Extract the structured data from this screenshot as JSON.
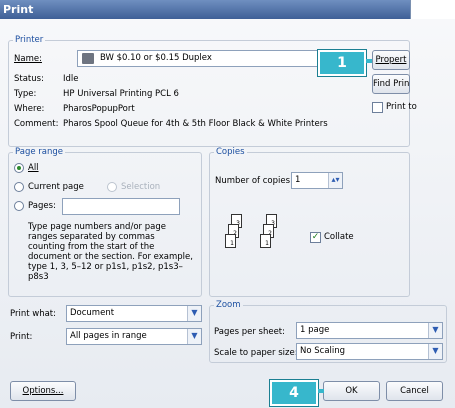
{
  "title": "Print",
  "printer": {
    "legend": "Printer",
    "name_label": "Name:",
    "name_value": "BW $0.10 or $0.15 Duplex",
    "status_label": "Status:",
    "status_value": "Idle",
    "type_label": "Type:",
    "type_value": "HP Universal Printing PCL 6",
    "where_label": "Where:",
    "where_value": "PharosPopupPort",
    "comment_label": "Comment:",
    "comment_value": "Pharos Spool Queue for 4th & 5th Floor Black & White Printers",
    "properties_button": "Propert",
    "find_printer_button": "Find Print",
    "print_to_file_label": "Print to"
  },
  "page_range": {
    "legend": "Page range",
    "all_label": "All",
    "current_page_label": "Current page",
    "selection_label": "Selection",
    "pages_label": "Pages:",
    "pages_value": "",
    "help_text": "Type page numbers and/or page ranges separated by commas counting from the start of the document or the section. For example, type 1, 3, 5–12 or p1s1, p1s2, p1s3–p8s3"
  },
  "copies": {
    "legend": "Copies",
    "number_label": "Number of copies:",
    "number_value": "1",
    "collate_label": "Collate",
    "collate_checked": true
  },
  "print_what": {
    "label": "Print what:",
    "value": "Document"
  },
  "print": {
    "label": "Print:",
    "value": "All pages in range"
  },
  "zoom": {
    "legend": "Zoom",
    "pages_per_sheet_label": "Pages per sheet:",
    "pages_per_sheet_value": "1 page",
    "scale_label": "Scale to paper size:",
    "scale_value": "No Scaling"
  },
  "buttons": {
    "options": "Options...",
    "ok": "OK",
    "cancel": "Cancel"
  },
  "callouts": {
    "one": "1",
    "four": "4"
  },
  "colors": {
    "accent": "#1c4fa0",
    "callout": "#37b7cc"
  }
}
